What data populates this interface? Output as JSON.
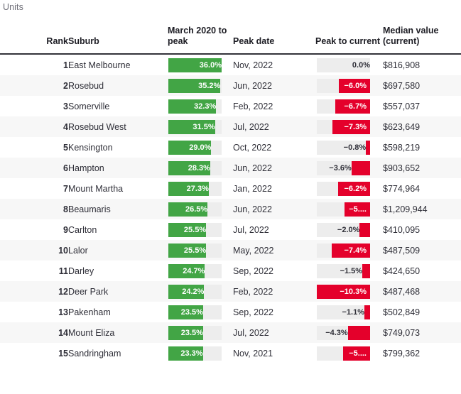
{
  "units_label": "Units",
  "colors": {
    "green": "#42a545",
    "red": "#e4002b",
    "track": "#ededed",
    "header_rule": "#33333a",
    "row_even": "#f7f7f7"
  },
  "table": {
    "headers": {
      "rank": "Rank",
      "suburb": "Suburb",
      "peak": "March 2020 to peak",
      "peak_date": "Peak date",
      "peak_to_current": "Peak to current",
      "median_value": "Median value (current)"
    },
    "rows": [
      {
        "rank": "1",
        "suburb": "East Melbourne",
        "peak_pct": "36.0%",
        "peak_pct_value": 36.0,
        "peak_date": "Nov, 2022",
        "ptc": "0.0%",
        "ptc_value": 0.0,
        "median": "$816,908"
      },
      {
        "rank": "2",
        "suburb": "Rosebud",
        "peak_pct": "35.2%",
        "peak_pct_value": 35.2,
        "peak_date": "Jun, 2022",
        "ptc": "−6.0%",
        "ptc_value": -6.0,
        "median": "$697,580"
      },
      {
        "rank": "3",
        "suburb": "Somerville",
        "peak_pct": "32.3%",
        "peak_pct_value": 32.3,
        "peak_date": "Feb, 2022",
        "ptc": "−6.7%",
        "ptc_value": -6.7,
        "median": "$557,037"
      },
      {
        "rank": "4",
        "suburb": "Rosebud West",
        "peak_pct": "31.5%",
        "peak_pct_value": 31.5,
        "peak_date": "Jul, 2022",
        "ptc": "−7.3%",
        "ptc_value": -7.3,
        "median": "$623,649"
      },
      {
        "rank": "5",
        "suburb": "Kensington",
        "peak_pct": "29.0%",
        "peak_pct_value": 29.0,
        "peak_date": "Oct, 2022",
        "ptc": "−0.8%",
        "ptc_value": -0.8,
        "median": "$598,219"
      },
      {
        "rank": "6",
        "suburb": "Hampton",
        "peak_pct": "28.3%",
        "peak_pct_value": 28.3,
        "peak_date": "Jun, 2022",
        "ptc": "−3.6%",
        "ptc_value": -3.6,
        "median": "$903,652"
      },
      {
        "rank": "7",
        "suburb": "Mount Martha",
        "peak_pct": "27.3%",
        "peak_pct_value": 27.3,
        "peak_date": "Jan, 2022",
        "ptc": "−6.2%",
        "ptc_value": -6.2,
        "median": "$774,964"
      },
      {
        "rank": "8",
        "suburb": "Beaumaris",
        "peak_pct": "26.5%",
        "peak_pct_value": 26.5,
        "peak_date": "Jun, 2022",
        "ptc": "−5....",
        "ptc_value": -5.0,
        "median": "$1,209,944"
      },
      {
        "rank": "9",
        "suburb": "Carlton",
        "peak_pct": "25.5%",
        "peak_pct_value": 25.5,
        "peak_date": "Jul, 2022",
        "ptc": "−2.0%",
        "ptc_value": -2.0,
        "median": "$410,095"
      },
      {
        "rank": "10",
        "suburb": "Lalor",
        "peak_pct": "25.5%",
        "peak_pct_value": 25.5,
        "peak_date": "May, 2022",
        "ptc": "−7.4%",
        "ptc_value": -7.4,
        "median": "$487,509"
      },
      {
        "rank": "11",
        "suburb": "Darley",
        "peak_pct": "24.7%",
        "peak_pct_value": 24.7,
        "peak_date": "Sep, 2022",
        "ptc": "−1.5%",
        "ptc_value": -1.5,
        "median": "$424,650"
      },
      {
        "rank": "12",
        "suburb": "Deer Park",
        "peak_pct": "24.2%",
        "peak_pct_value": 24.2,
        "peak_date": "Feb, 2022",
        "ptc": "−10.3%",
        "ptc_value": -10.3,
        "median": "$487,468"
      },
      {
        "rank": "13",
        "suburb": "Pakenham",
        "peak_pct": "23.5%",
        "peak_pct_value": 23.5,
        "peak_date": "Sep, 2022",
        "ptc": "−1.1%",
        "ptc_value": -1.1,
        "median": "$502,849"
      },
      {
        "rank": "14",
        "suburb": "Mount Eliza",
        "peak_pct": "23.5%",
        "peak_pct_value": 23.5,
        "peak_date": "Jul, 2022",
        "ptc": "−4.3%",
        "ptc_value": -4.3,
        "median": "$749,073"
      },
      {
        "rank": "15",
        "suburb": "Sandringham",
        "peak_pct": "23.3%",
        "peak_pct_value": 23.3,
        "peak_date": "Nov, 2021",
        "ptc": "−5....",
        "ptc_value": -5.2,
        "median": "$799,362"
      }
    ]
  },
  "chart_data": {
    "type": "table",
    "title": "Units",
    "columns": [
      "Rank",
      "Suburb",
      "March 2020 to peak",
      "Peak date",
      "Peak to current",
      "Median value (current)"
    ],
    "categories": [
      "East Melbourne",
      "Rosebud",
      "Somerville",
      "Rosebud West",
      "Kensington",
      "Hampton",
      "Mount Martha",
      "Beaumaris",
      "Carlton",
      "Lalor",
      "Darley",
      "Deer Park",
      "Pakenham",
      "Mount Eliza",
      "Sandringham"
    ],
    "series": [
      {
        "name": "March 2020 to peak (%)",
        "values": [
          36.0,
          35.2,
          32.3,
          31.5,
          29.0,
          28.3,
          27.3,
          26.5,
          25.5,
          25.5,
          24.7,
          24.2,
          23.5,
          23.5,
          23.3
        ]
      },
      {
        "name": "Peak to current (%)",
        "values": [
          0.0,
          -6.0,
          -6.7,
          -7.3,
          -0.8,
          -3.6,
          -6.2,
          -5.0,
          -2.0,
          -7.4,
          -1.5,
          -10.3,
          -1.1,
          -4.3,
          -5.2
        ]
      }
    ],
    "peak_dates": [
      "Nov, 2022",
      "Jun, 2022",
      "Feb, 2022",
      "Jul, 2022",
      "Oct, 2022",
      "Jun, 2022",
      "Jan, 2022",
      "Jun, 2022",
      "Jul, 2022",
      "May, 2022",
      "Sep, 2022",
      "Feb, 2022",
      "Sep, 2022",
      "Jul, 2022",
      "Nov, 2021"
    ],
    "median_values": [
      816908,
      697580,
      557037,
      623649,
      598219,
      903652,
      774964,
      1209944,
      410095,
      487509,
      424650,
      487468,
      502849,
      749073,
      799362
    ],
    "bar_scale_peak_max": 36.0,
    "bar_scale_ptc_max": 10.3,
    "grid": false,
    "legend": "none"
  }
}
